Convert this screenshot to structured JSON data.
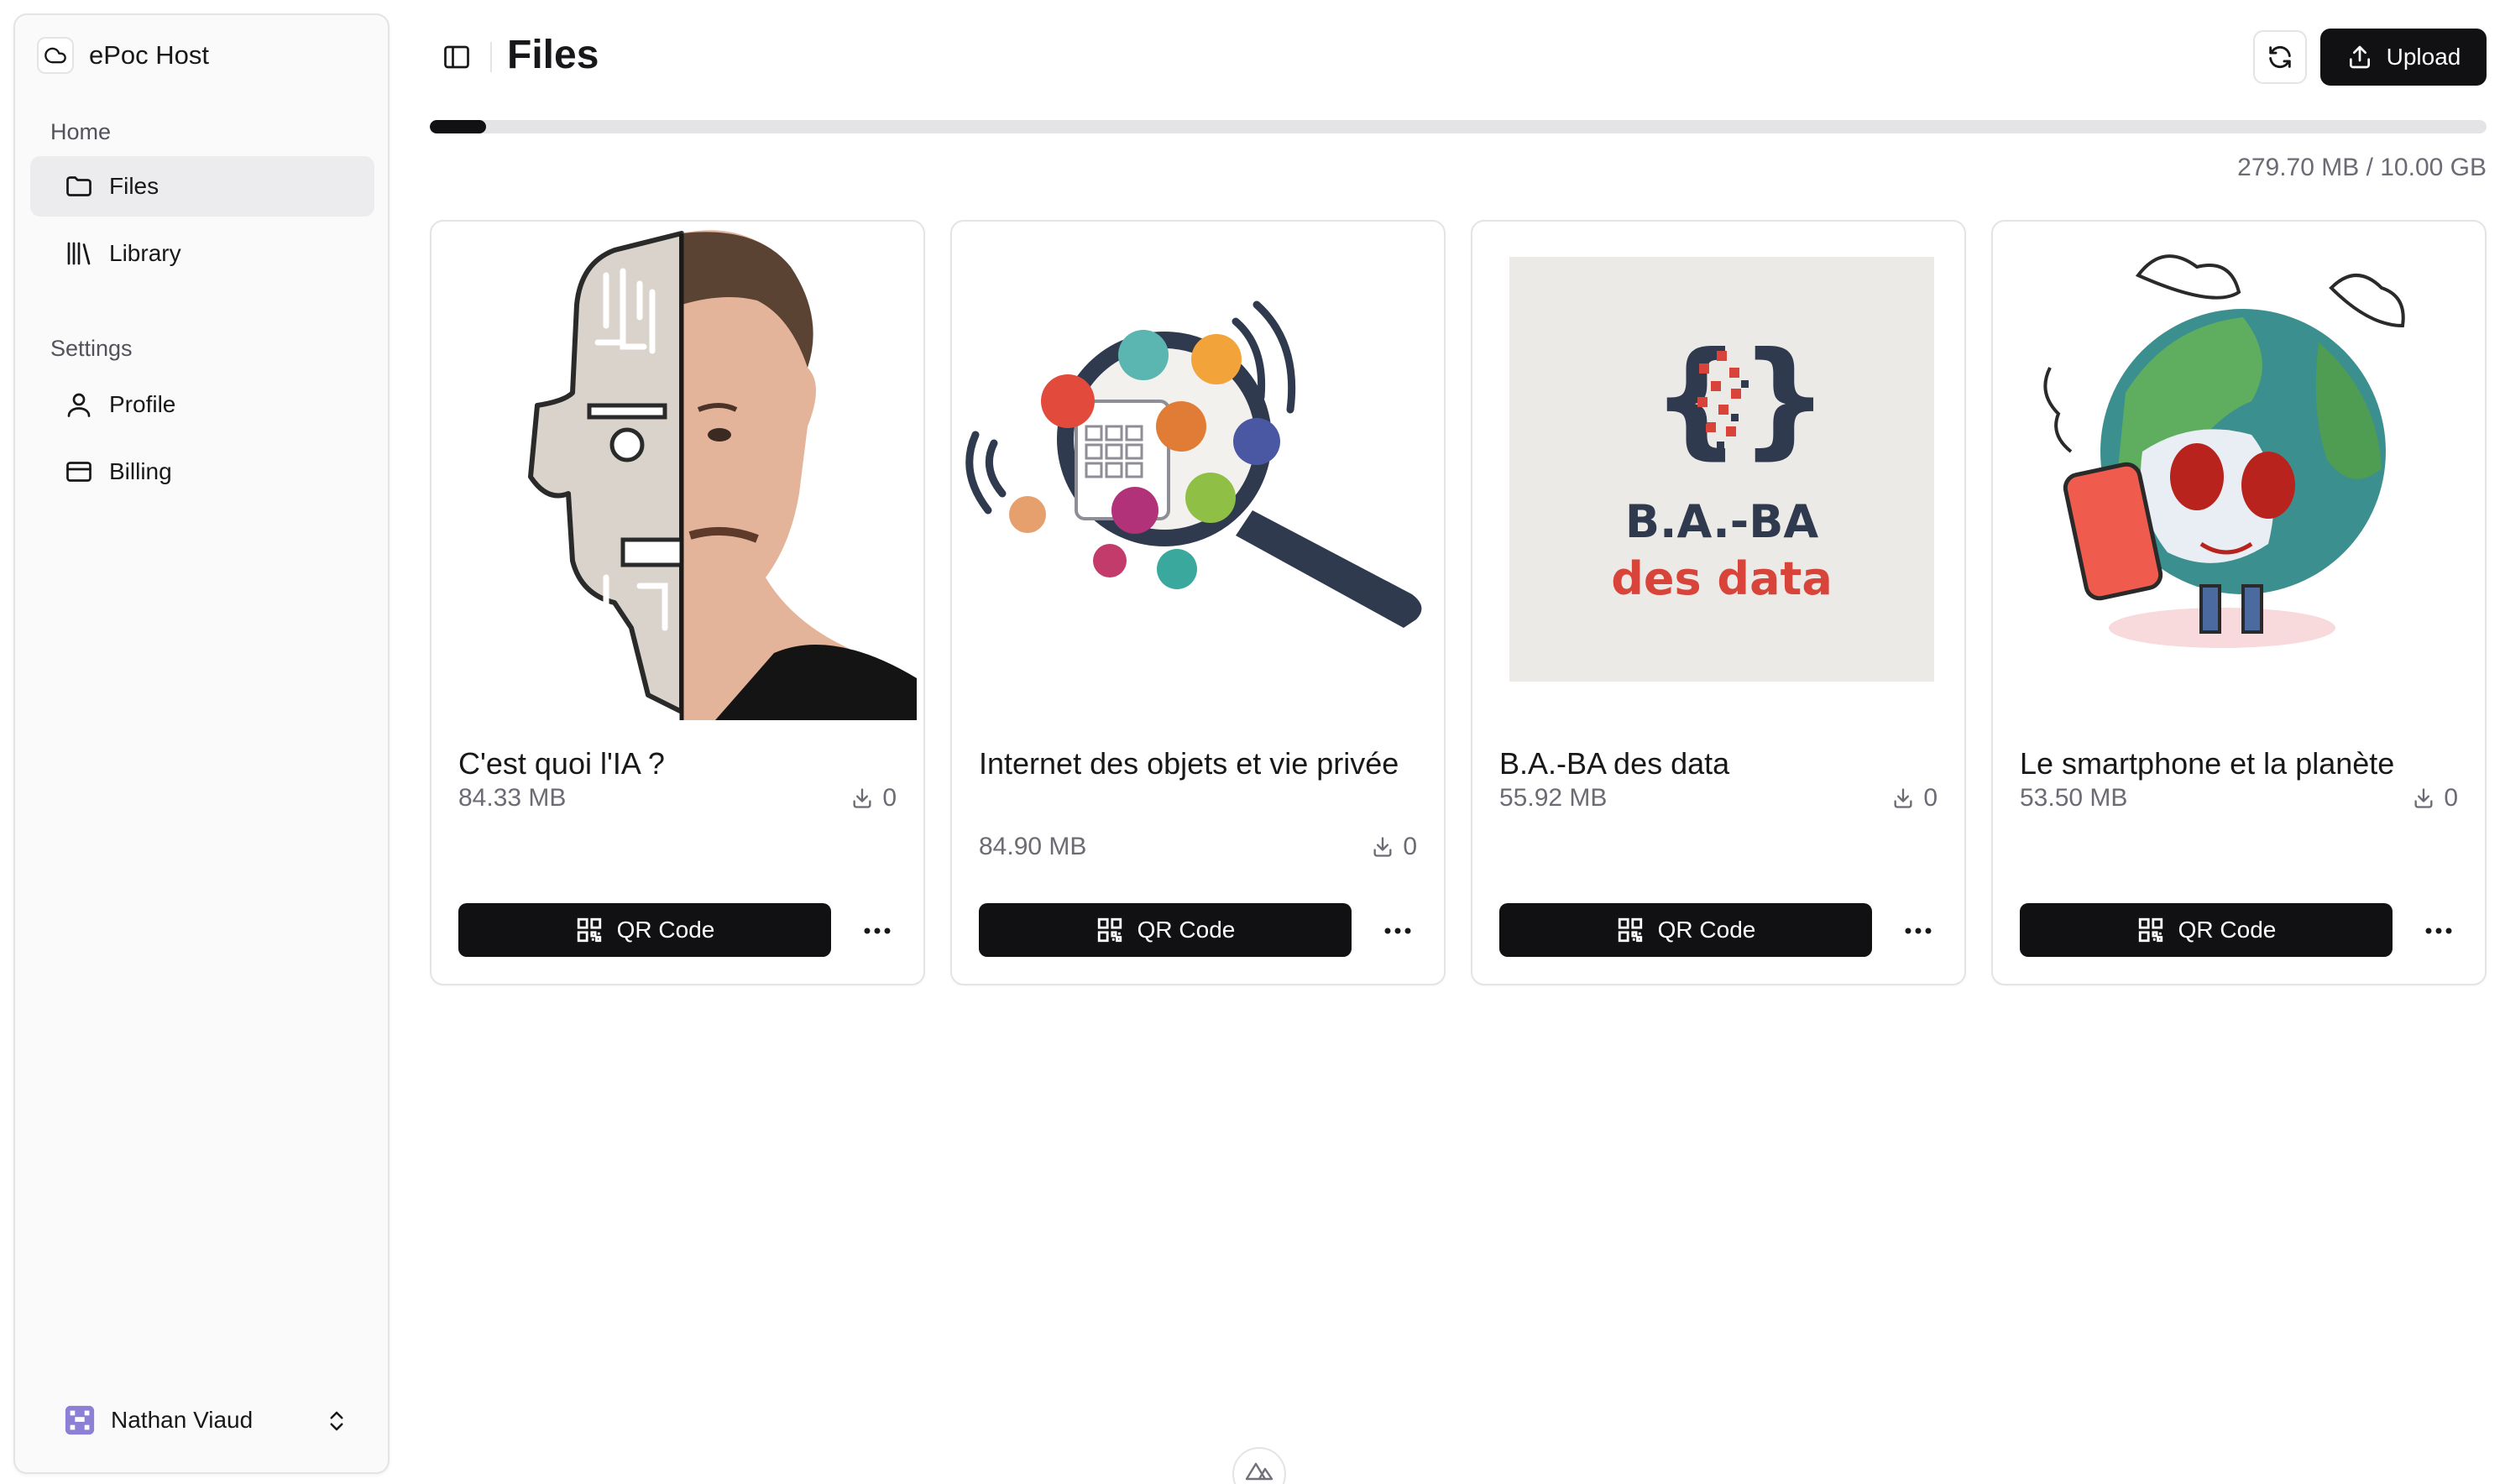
{
  "app": {
    "name": "ePoc Host"
  },
  "sidebar": {
    "home_label": "Home",
    "settings_label": "Settings",
    "items": [
      {
        "label": "Files",
        "icon": "folder-icon",
        "active": true
      },
      {
        "label": "Library",
        "icon": "library-icon",
        "active": false
      },
      {
        "label": "Profile",
        "icon": "user-icon",
        "active": false
      },
      {
        "label": "Billing",
        "icon": "credit-card-icon",
        "active": false
      }
    ],
    "user": {
      "name": "Nathan Viaud"
    }
  },
  "header": {
    "title": "Files",
    "upload_label": "Upload"
  },
  "storage": {
    "text": "279.70 MB / 10.00 GB",
    "used_fraction": 0.0273
  },
  "cards": [
    {
      "title": "C'est quoi l'IA ?",
      "size": "84.33 MB",
      "downloads": "0",
      "qr_label": "QR Code"
    },
    {
      "title": "Internet des objets et vie privée",
      "size": "84.90 MB",
      "downloads": "0",
      "qr_label": "QR Code"
    },
    {
      "title": "B.A.-BA des data",
      "size": "55.92 MB",
      "downloads": "0",
      "qr_label": "QR Code"
    },
    {
      "title": "Le smartphone et la planète",
      "size": "53.50 MB",
      "downloads": "0",
      "qr_label": "QR Code"
    }
  ],
  "card3_image": {
    "line1": "B.A.-BA",
    "line2": "des data"
  },
  "colors": {
    "accent": "#111113",
    "border": "#e4e4e7",
    "muted": "#6b6b73",
    "data_red": "#d9443a",
    "data_navy": "#2f3a4f"
  }
}
